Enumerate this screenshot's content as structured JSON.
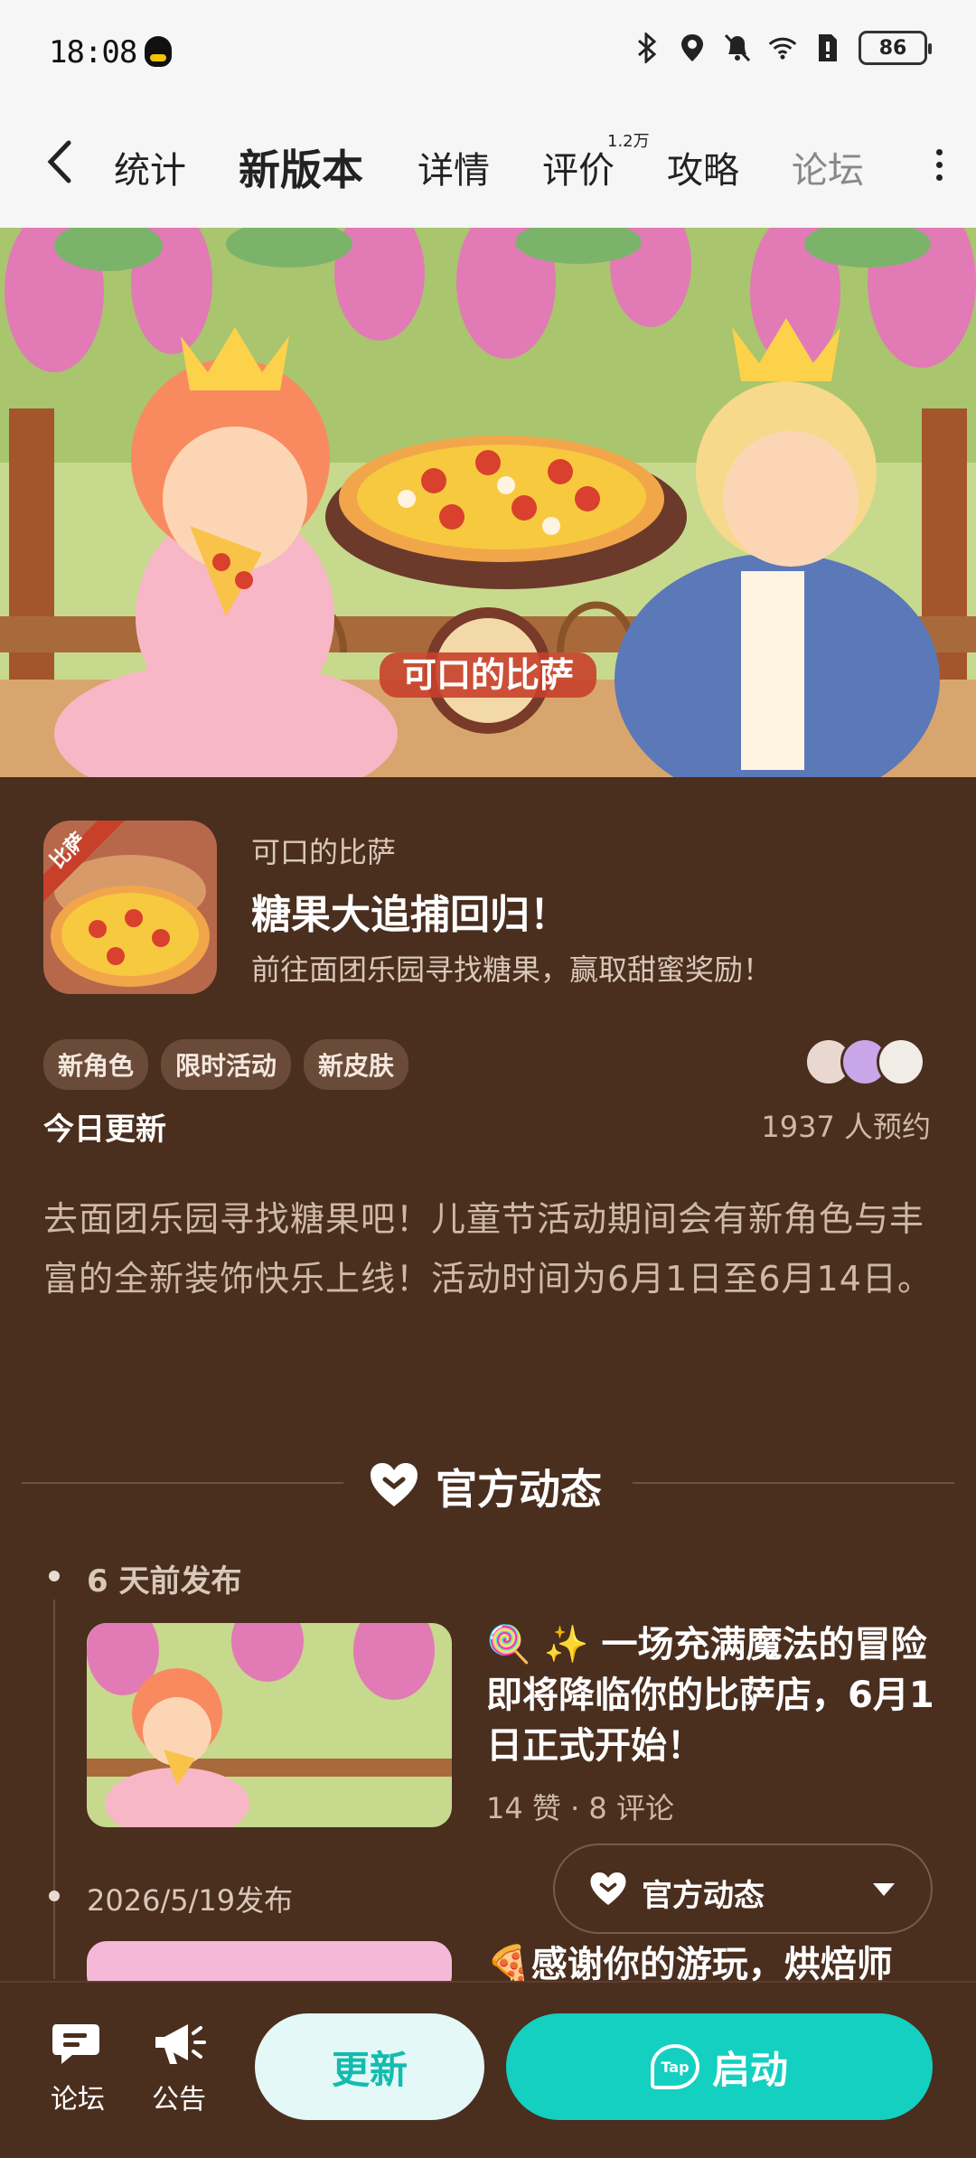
{
  "status_bar": {
    "time": "18:08",
    "battery": "86",
    "icons": [
      "bluetooth-icon",
      "location-icon",
      "mute-icon",
      "wifi-icon",
      "sim-icon"
    ]
  },
  "tabs": {
    "items": [
      {
        "label": "统计"
      },
      {
        "label": "新版本"
      },
      {
        "label": "详情"
      },
      {
        "label": "评价"
      },
      {
        "label": "攻略"
      },
      {
        "label": "论坛"
      }
    ],
    "review_badge": "1.2万",
    "accent": "#12d6c5"
  },
  "banner": {
    "logo_text": "可口的比萨"
  },
  "game": {
    "icon_badge": "比萨",
    "name": "可口的比萨",
    "update_title": "糖果大追捕回归！",
    "update_subtitle": "前往面团乐园寻找糖果，赢取甜蜜奖励！",
    "tags": [
      "新角色",
      "限时活动",
      "新皮肤"
    ],
    "update_today": "今日更新",
    "reservations": "1937 人预约",
    "description": "去面团乐园寻找糖果吧！儿童节活动期间会有新角色与丰富的全新装饰快乐上线！活动时间为6月1日至6月14日。"
  },
  "section": {
    "title": "官方动态"
  },
  "posts": [
    {
      "date": "6 天前发布",
      "text": "🍭 ✨ 一场充满魔法的冒险即将降临你的比萨店，6月1日正式开始！",
      "meta": "14 赞 · 8 评论"
    },
    {
      "date": "2026/5/19发布",
      "text": "🍕感谢你的游玩，烘焙师"
    }
  ],
  "floating_filter": {
    "label": "官方动态"
  },
  "bottom_bar": {
    "forum": "论坛",
    "announcement": "公告",
    "update_button": "更新",
    "launch_button": "启动",
    "tap_logo": "Tap"
  },
  "colors": {
    "background": "#4a2e1e",
    "accent": "#14d0c0",
    "top_bar": "#f6f6f7"
  }
}
